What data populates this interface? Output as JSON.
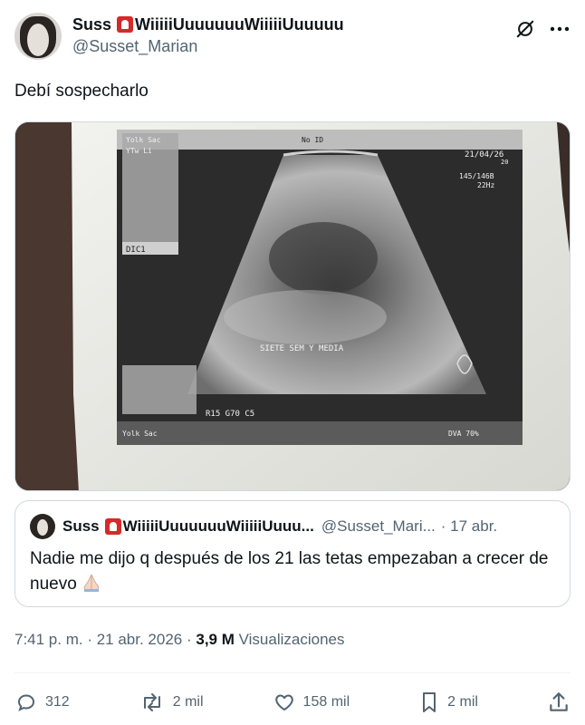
{
  "author": {
    "name_prefix": "Suss",
    "name_suffix": "WiiiiiUuuuuuuWiiiiiUuuuuu",
    "handle": "@Susset_Marian"
  },
  "tweet": {
    "text": "Debí sospecharlo",
    "image": {
      "overlay_topleft_1": "Yolk Sac",
      "overlay_topleft_2": "YTw Li",
      "overlay_no_id": "No ID",
      "overlay_date": "21/04/26",
      "overlay_date_small": "20",
      "overlay_freq_1": "145/146B",
      "overlay_freq_2": "22Hz",
      "overlay_dici": "DIC1",
      "overlay_center": "SIETE SEM Y MEDIA",
      "overlay_param": "R15 G70 C5",
      "overlay_bottom_left": "Yolk Sac",
      "overlay_bottom_right": "DVA  70%"
    }
  },
  "quote": {
    "name_prefix": "Suss",
    "name_suffix": "WiiiiiUuuuuuuWiiiiiUuuu...",
    "handle": "@Susset_Mari...",
    "date": "· 17 abr.",
    "text": "Nadie me dijo q después de los 21 las tetas empezaban a crecer de nuevo"
  },
  "meta": {
    "time": "7:41 p. m. · 21 abr. 2026 ·",
    "views_count": "3,9 M",
    "views_label": "Visualizaciones"
  },
  "actions": {
    "replies": "312",
    "reposts": "2 mil",
    "likes": "158 mil",
    "bookmarks": "2 mil"
  },
  "colors": {
    "text": "#0f1419",
    "secondary": "#536471",
    "border": "#cfd9de",
    "siren": "#d42a2a"
  },
  "icons": [
    "grok-icon",
    "more-icon",
    "reply-icon",
    "repost-icon",
    "like-icon",
    "bookmark-icon",
    "share-icon",
    "siren-emoji",
    "praying-hands-emoji"
  ]
}
